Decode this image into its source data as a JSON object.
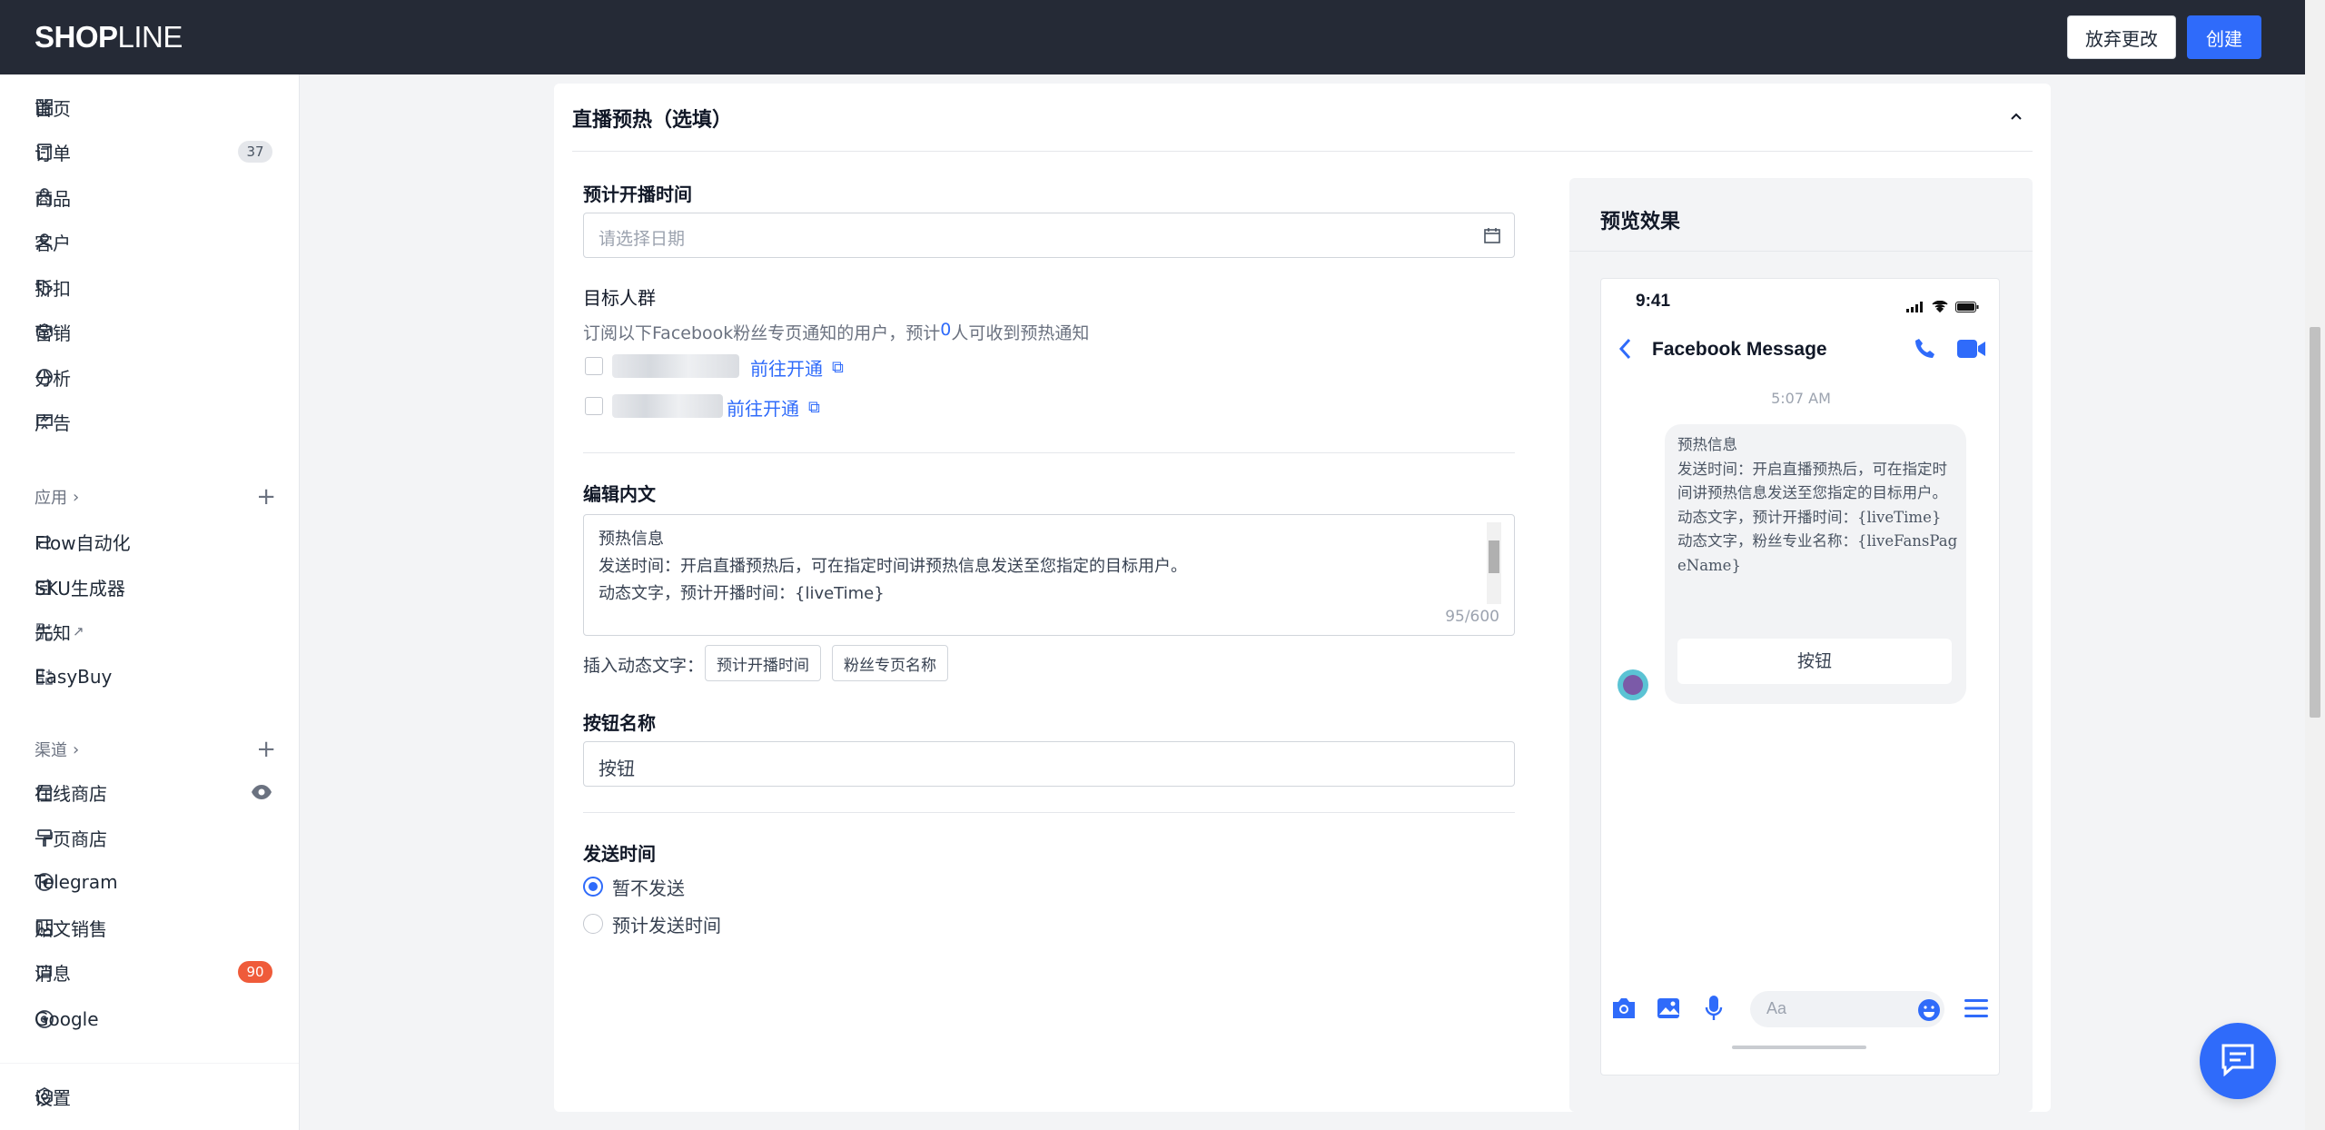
{
  "header": {
    "logo_bold": "SHOP",
    "logo_lite": "LINE",
    "discard_label": "放弃更改",
    "create_label": "创建"
  },
  "sidebar": {
    "items": [
      {
        "label": "首页",
        "icon": "home-icon"
      },
      {
        "label": "订单",
        "icon": "order-icon",
        "badge": "37"
      },
      {
        "label": "商品",
        "icon": "product-icon"
      },
      {
        "label": "客户",
        "icon": "customer-icon"
      },
      {
        "label": "折扣",
        "icon": "discount-icon"
      },
      {
        "label": "营销",
        "icon": "marketing-icon"
      },
      {
        "label": "分析",
        "icon": "analytics-icon"
      },
      {
        "label": "广告",
        "icon": "ads-icon"
      }
    ],
    "apps_section": "应用",
    "apps": [
      {
        "label": "Flow自动化"
      },
      {
        "label": "SKU生成器"
      },
      {
        "label": "先知"
      },
      {
        "label": "EasyBuy"
      }
    ],
    "channels_section": "渠道",
    "channels": [
      {
        "label": "在线商店"
      },
      {
        "label": "一页商店"
      },
      {
        "label": "Telegram"
      },
      {
        "label": "贴文销售"
      },
      {
        "label": "消息",
        "badge": "90"
      },
      {
        "label": "Google"
      }
    ],
    "settings": "设置"
  },
  "section": {
    "title": "直播预热（选填）",
    "scheduled_time_label": "预计开播时间",
    "date_placeholder": "请选择日期",
    "audience_label": "目标人群",
    "audience_desc_pre": "订阅以下Facebook粉丝专页通知的用户，预计 ",
    "audience_count": "0",
    "audience_desc_post": " 人可收到预热通知",
    "open_link": "前往开通",
    "content_label": "编辑内文",
    "content_lines": [
      "预热信息",
      "发送时间：开启直播预热后，可在指定时间讲预热信息发送至您指定的目标用户。",
      "动态文字，预计开播时间：{liveTime}"
    ],
    "char_count": "95/600",
    "insert_label": "插入动态文字：",
    "insert_time": "预计开播时间",
    "insert_page": "粉丝专页名称",
    "button_name_label": "按钮名称",
    "button_name_value": "按钮",
    "send_time_label": "发送时间",
    "send_options": [
      "暂不发送",
      "预计发送时间"
    ],
    "send_selected": 0
  },
  "preview": {
    "title": "预览效果",
    "phone_time": "9:41",
    "chat_title": "Facebook Message",
    "timestamp": "5:07 AM",
    "bubble_text": "预热信息\n发送时间：开启直播预热后，可在指定时间讲预热信息发送至您指定的目标用户。\n动态文字，预计开播时间：{liveTime}\n动态文字，粉丝专业名称：{liveFansPageName}",
    "bubble_button": "按钮",
    "compose_placeholder": "Aa"
  },
  "colors": {
    "accent": "#2f6bfa",
    "topbar": "#252a36",
    "badge_red": "#ef5b3a"
  }
}
